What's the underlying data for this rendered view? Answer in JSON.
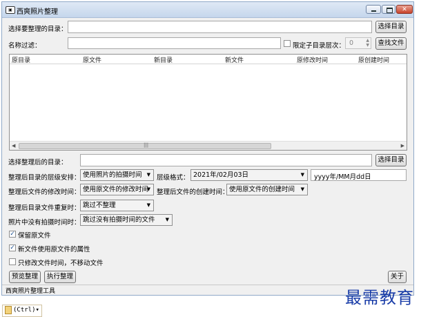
{
  "window": {
    "title": "西爽照片整理",
    "app_icon": "camera-icon"
  },
  "row1": {
    "label": "选择要整理的目录：",
    "value": "",
    "button": "选择目录"
  },
  "row2": {
    "label": "名称过滤：",
    "value": "",
    "limit_label": "限定子目录层次：",
    "limit_value": "0",
    "button": "查找文件"
  },
  "table": {
    "columns": [
      "原目录",
      "原文件",
      "新目录",
      "新文件",
      "原修改时间",
      "原创建时间"
    ],
    "rows": []
  },
  "target": {
    "label": "选择整理后的目录：",
    "value": "",
    "button": "选择目录"
  },
  "arrange": {
    "label": "整理后目录的层级安排：",
    "selected": "使用照片的拍摄时间",
    "format_label": "层级格式：",
    "format_selected": "2021年/02月03日",
    "format_pattern": "yyyy年/MM月dd日"
  },
  "mtime": {
    "label": "整理后文件的修改时间：",
    "selected": "使用原文件的修改时间"
  },
  "ctime": {
    "label": "整理后文件的创建时间：",
    "selected": "使用原文件的创建时间"
  },
  "duplicate": {
    "label": "整理后目录文件重复时：",
    "selected": "跳过不整理"
  },
  "no_time": {
    "label": "照片中没有拍摄时间时：",
    "selected": "跳过没有拍摄时间的文件"
  },
  "options": [
    {
      "label": "保留原文件",
      "checked": true
    },
    {
      "label": "新文件使用原文件的属性",
      "checked": true
    },
    {
      "label": "只修改文件时间，不移动文件",
      "checked": false
    }
  ],
  "buttons": {
    "preview": "预览整理",
    "run": "执行整理",
    "about": "关于"
  },
  "status": "西爽照片整理工具",
  "watermark": "最需教育",
  "ctrl_chip": "(Ctrl)▾"
}
